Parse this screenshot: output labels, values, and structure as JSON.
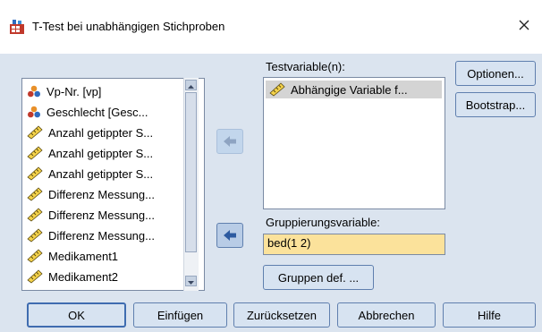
{
  "window": {
    "title": "T-Test bei unabhängigen Stichproben",
    "close_glyph": "✕"
  },
  "source_list": {
    "items": [
      {
        "label": "Vp-Nr. [vp]",
        "icon": "nominal-icon"
      },
      {
        "label": "Geschlecht [Gesc...",
        "icon": "nominal-icon"
      },
      {
        "label": "Anzahl getippter S...",
        "icon": "scale-icon"
      },
      {
        "label": "Anzahl getippter S...",
        "icon": "scale-icon"
      },
      {
        "label": "Anzahl getippter S...",
        "icon": "scale-icon"
      },
      {
        "label": "Differenz Messung...",
        "icon": "scale-icon"
      },
      {
        "label": "Differenz Messung...",
        "icon": "scale-icon"
      },
      {
        "label": "Differenz Messung...",
        "icon": "scale-icon"
      },
      {
        "label": "Medikament1",
        "icon": "scale-icon"
      },
      {
        "label": "Medikament2",
        "icon": "scale-icon"
      }
    ]
  },
  "test_variables": {
    "label": "Testvariable(n):",
    "items": [
      {
        "label": "Abhängige Variable f...",
        "icon": "scale-icon"
      }
    ]
  },
  "grouping": {
    "label": "Gruppierungsvariable:",
    "value": "bed(1 2)",
    "define_button": "Gruppen def. ..."
  },
  "side_buttons": {
    "options": "Optionen...",
    "bootstrap": "Bootstrap..."
  },
  "footer_buttons": {
    "ok": "OK",
    "paste": "Einfügen",
    "reset": "Zurücksetzen",
    "cancel": "Abbrechen",
    "help": "Hilfe"
  },
  "colors": {
    "dialog_bg": "#dbe4ef",
    "button_bg": "#d7e3f1",
    "grouping_field_bg": "#fbe29b",
    "selected_item_bg": "#d4d4d4"
  }
}
